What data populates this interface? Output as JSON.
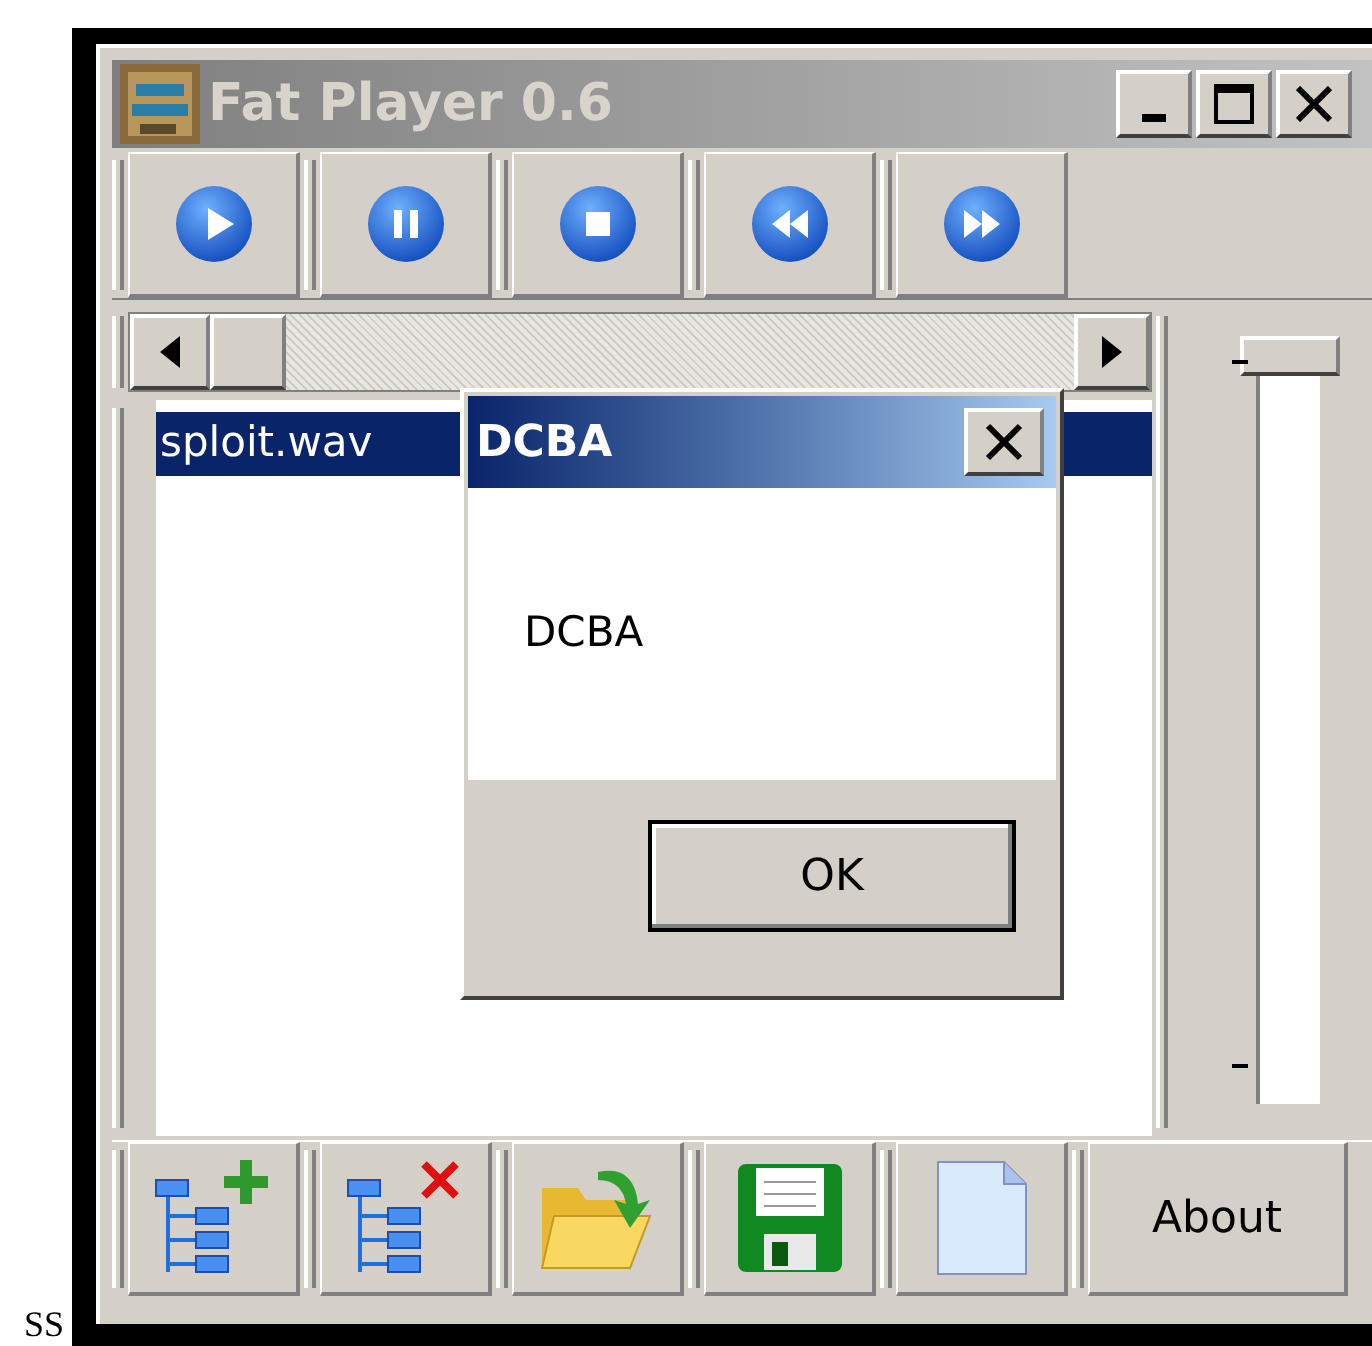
{
  "window": {
    "title": "Fat Player 0.6"
  },
  "playlist": {
    "items": [
      {
        "name": "sploit.wav",
        "selected": true
      }
    ]
  },
  "volume": {
    "level": 1
  },
  "bottom_toolbar": {
    "about_button": "About"
  },
  "dialog": {
    "title": "DCBA",
    "message": "DCBA",
    "ok_button": "OK"
  },
  "footer_text": "SS"
}
